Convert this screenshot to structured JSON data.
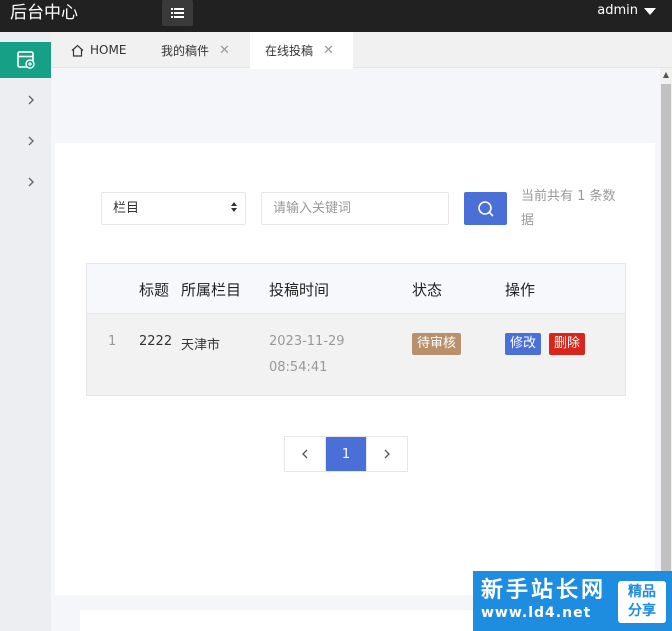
{
  "header": {
    "brand": "后台中心",
    "menu_icon": "list-icon",
    "user": "admin"
  },
  "sidebar": {
    "active_icon": "document-icon",
    "items": [
      {
        "icon": "chevron-right-icon"
      },
      {
        "icon": "chevron-right-icon"
      },
      {
        "icon": "chevron-right-icon"
      }
    ]
  },
  "tabs": [
    {
      "label": "HOME",
      "icon": "home-icon"
    },
    {
      "label": "我的稿件",
      "close": "✕"
    },
    {
      "label": "在线投稿",
      "close": "✕",
      "active": true
    }
  ],
  "filter": {
    "category_select": "栏目",
    "search_placeholder": "请输入关键词",
    "count_text": "当前共有 1 条数据"
  },
  "table": {
    "columns": [
      "",
      "标题",
      "所属栏目",
      "投稿时间",
      "状态",
      "操作"
    ],
    "rows": [
      {
        "index": "1",
        "title": "2222",
        "category": "天津市",
        "date": "2023-11-29",
        "time": "08:54:41",
        "status": "待审核",
        "edit": "修改",
        "delete": "删除"
      }
    ]
  },
  "pagination": {
    "prev": "‹",
    "current": "1",
    "next": "›"
  },
  "watermark": {
    "main": "新手站长网",
    "sub": "www.ld4.net",
    "seal_line1": "精品",
    "seal_line2": "分享"
  },
  "colors": {
    "header_bg": "#212121",
    "sidebar_active": "#16a085",
    "primary": "#4a6fd6",
    "danger": "#d9261c",
    "pending": "#b8916c",
    "watermark_bg": "#1e8de0"
  }
}
